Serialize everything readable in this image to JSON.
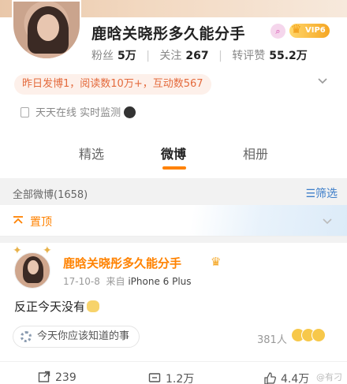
{
  "profile": {
    "name": "鹿晗关晓彤多久能分手",
    "vip_label": "VIP6",
    "stats": [
      {
        "label": "粉丝",
        "value": "5万"
      },
      {
        "label": "关注",
        "value": "267"
      },
      {
        "label": "转评赞",
        "value": "55.2万"
      }
    ],
    "daily_summary": "昨日发博1，阅读数10万+，互动数567",
    "online_status": "天天在线 实时监测"
  },
  "tabs": [
    {
      "label": "精选",
      "active": false
    },
    {
      "label": "微博",
      "active": true
    },
    {
      "label": "相册",
      "active": false
    }
  ],
  "filterbar": {
    "all_label": "全部微博(1658)",
    "filter_label": "筛选"
  },
  "pinned": {
    "label": "置顶"
  },
  "post": {
    "author": "鹿晗关晓彤多久能分手",
    "date": "17-10-8",
    "source_prefix": "来自",
    "device": "iPhone 6 Plus",
    "text": "反正今天没有",
    "topic": "今天你应该知道的事",
    "likes_count": "381人"
  },
  "actions": [
    {
      "icon": "repost-icon",
      "value": "239"
    },
    {
      "icon": "comment-icon",
      "value": "1.2万"
    },
    {
      "icon": "like-icon",
      "value": "4.4万"
    }
  ],
  "watermark": "@有刁",
  "colors": {
    "accent": "#ff8200",
    "link": "#3d7ec9",
    "summary_bg": "#fdf0ea"
  }
}
